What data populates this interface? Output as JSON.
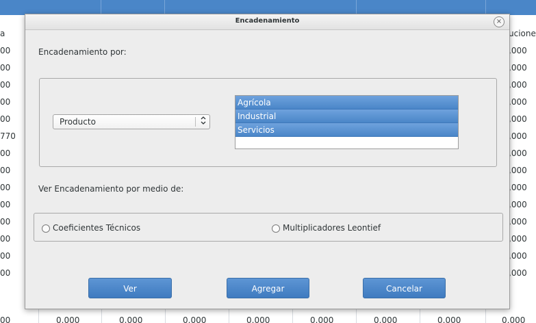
{
  "background": {
    "left_column": [
      "a",
      "00",
      "00",
      "00",
      "00",
      "00",
      "770",
      "00",
      "00",
      "00",
      "00",
      "00",
      "00",
      "00",
      "00"
    ],
    "right_column": [
      "ucione",
      ",000",
      ",000",
      ",000",
      ",000",
      ",000",
      ",000",
      ",000",
      ",000",
      ",000",
      ",000",
      ",000",
      ",000",
      ",000",
      ",000"
    ],
    "bottom_row": [
      "00",
      "0.000",
      "0.000",
      "0.000",
      "0.000",
      "0.000",
      "0.000",
      "0.000",
      "0.000"
    ]
  },
  "dialog": {
    "title": "Encadenamiento",
    "close_glyph": "×",
    "chain_by_label": "Encadenamiento por:",
    "combo_value": "Producto",
    "combo_arrows": "⌃⌄",
    "list_items": [
      "Agrícola",
      "Industrial",
      "Servicios"
    ],
    "view_by_label": "Ver Encadenamiento por medio de:",
    "radio_options": [
      "Coeficientes Técnicos",
      "Multiplicadores Leontief"
    ],
    "buttons": {
      "ver": "Ver",
      "agregar": "Agregar",
      "cancelar": "Cancelar"
    },
    "accent_color": "#4a86c8"
  }
}
